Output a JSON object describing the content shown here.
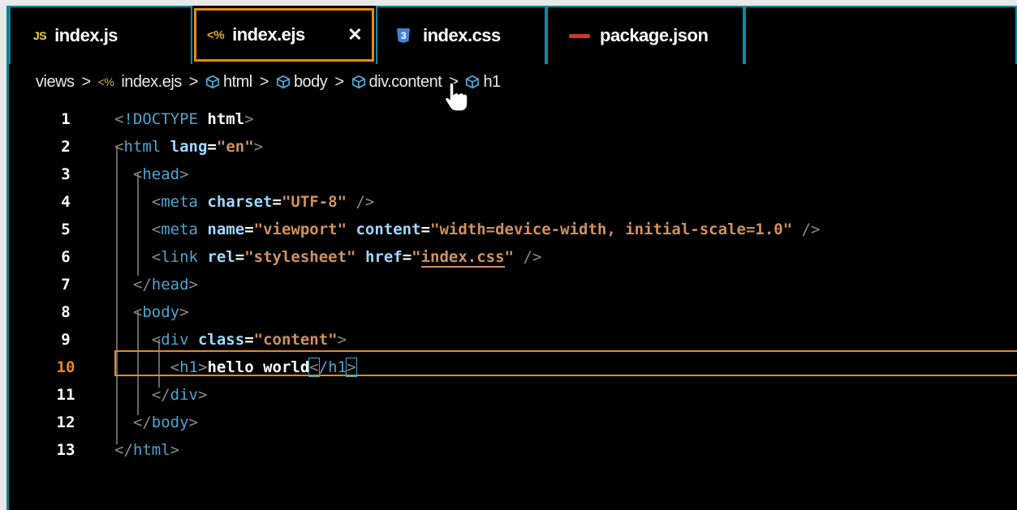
{
  "tabs": [
    {
      "icon": "js-icon",
      "icon_text": "JS",
      "label": "index.js",
      "active": false
    },
    {
      "icon": "ejs-icon",
      "icon_text": "<%",
      "label": "index.ejs",
      "active": true,
      "close": "✕"
    },
    {
      "icon": "css-icon",
      "icon_text": "3",
      "label": "index.css",
      "active": false
    },
    {
      "icon": "json-icon",
      "icon_text": "",
      "label": "package.json",
      "active": false
    }
  ],
  "breadcrumb": {
    "folder": "views",
    "file_icon": "<%",
    "file": "index.ejs",
    "items": [
      "html",
      "body",
      "div.content",
      "h1"
    ]
  },
  "editor": {
    "current_line": 10,
    "line_numbers": [
      "1",
      "2",
      "3",
      "4",
      "5",
      "6",
      "7",
      "8",
      "9",
      "10",
      "11",
      "12",
      "13"
    ]
  },
  "colors": {
    "accent_orange": "#e58b16",
    "tab_border_teal": "#0f8aa0",
    "tag": "#4fa3d1",
    "attribute": "#9fd8ff",
    "string": "#ce9161"
  }
}
